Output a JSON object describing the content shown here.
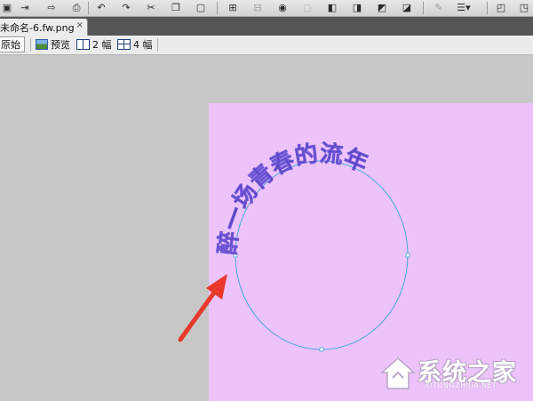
{
  "toolbar": {
    "icons": [
      "import-icon",
      "export-icon",
      "print-icon",
      "undo-icon",
      "redo-icon",
      "cut-icon",
      "copy-icon",
      "paste-icon",
      "group-icon",
      "ungroup-icon",
      "join-icon",
      "split-icon",
      "bring-forward-icon",
      "send-backward-icon",
      "align-icon"
    ]
  },
  "document": {
    "tab_title": "未命名-6.fw.png",
    "close_glyph": "×"
  },
  "viewbar": {
    "original_label": "原始",
    "preview_label": "预览",
    "two_up_label": "2 幅",
    "four_up_label": "4 幅"
  },
  "canvas": {
    "background": "#edc3fb",
    "arc_text": "醉一场青春的流年",
    "text_color": "#3a2aa8",
    "path_color": "#47a9d6",
    "arrow_color": "#e8392c"
  },
  "watermark": {
    "text": "系统之家",
    "sub": "XITONGZHIJIA.NET"
  }
}
